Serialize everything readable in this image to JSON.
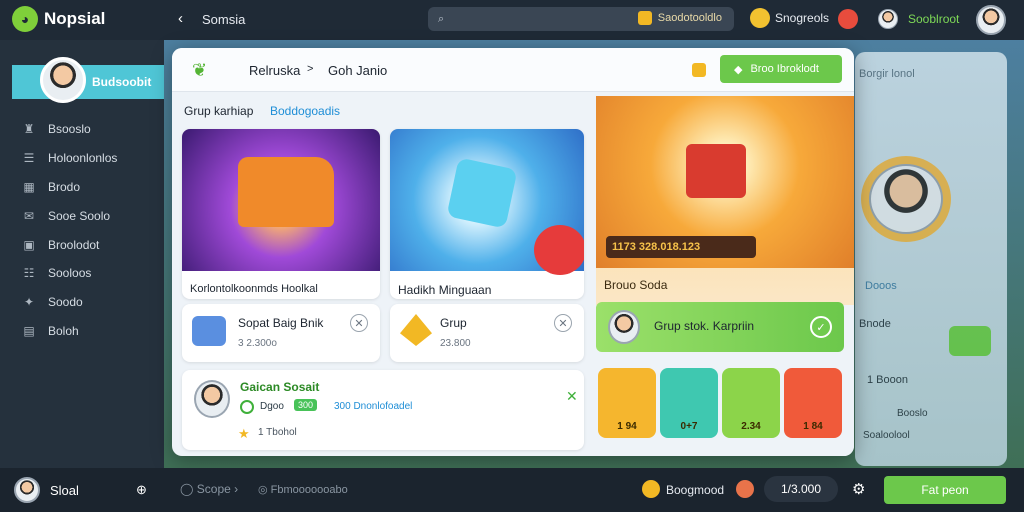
{
  "app": {
    "name": "Nopsial"
  },
  "header": {
    "back_label": "Somsia",
    "search_tag": "Saodotooldlo",
    "right_label_1": "Snogreols",
    "right_label_2": "Sooblroot"
  },
  "sidebar": {
    "user_label": "Budsoobit",
    "items": [
      {
        "label": "Bsooslo",
        "icon": "trophy-icon"
      },
      {
        "label": "Holoonlonlos",
        "icon": "list-icon"
      },
      {
        "label": "Brodo",
        "icon": "grid-icon"
      },
      {
        "label": "Sooe Soolo",
        "icon": "chat-icon"
      },
      {
        "label": "Broolodot",
        "icon": "gift-icon"
      },
      {
        "label": "Sooloos",
        "icon": "users-icon"
      },
      {
        "label": "Soodo",
        "icon": "star-icon"
      },
      {
        "label": "Boloh",
        "icon": "settings-icon"
      }
    ]
  },
  "modal": {
    "breadcrumb_1": "Relruska",
    "breadcrumb_sep": ">",
    "breadcrumb_2": "Goh Janio",
    "action_button": "Broo Ibroklodt",
    "section_title": "Grup karhiap",
    "section_link": "Boddogoadis",
    "card1_title": "Korlontolkoonmds Hoolkal",
    "card2_title": "Hadikh Minguaan",
    "item1_title": "Sopat Baig Bnik",
    "item1_sub": "3 2.300o",
    "item2_title": "Grup",
    "item2_sub": "23.800",
    "friend_name": "Gaican Sosait",
    "friend_tag": "Dgoo",
    "friend_count": "300",
    "friend_desc": "300 Dnonlofoadel",
    "friend_sub": "1 Tbohol",
    "promo_amount": "1173 328.018.123",
    "promo_caption": "Brouo Soda",
    "promo_button": "Grup stok. Karpriin",
    "tiles": [
      "1 94",
      "0+7",
      "2.34",
      "1 84"
    ]
  },
  "right_panel": {
    "header": "Borgir lonol",
    "label_1": "Dooos",
    "label_2": "Bnode",
    "label_3": "1 Booon",
    "label_4": "Booslo",
    "label_5": "Soaloolool"
  },
  "bottombar": {
    "user": "Sloal",
    "link_1": "Scope",
    "link_2": "Fbmooooooabo",
    "right_label": "Boogmood",
    "amount": "1/3.000",
    "cta": "Fat peon"
  },
  "colors": {
    "accent_green": "#7ad34b",
    "accent_cyan": "#4fc6d6",
    "dark": "#1f2a36"
  }
}
